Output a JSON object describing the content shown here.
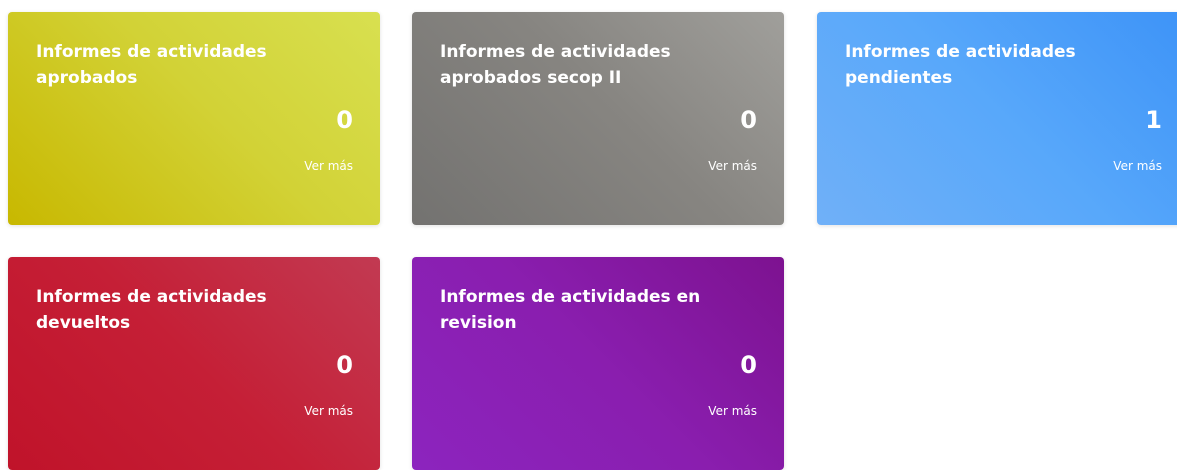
{
  "cards": [
    {
      "title": "Informes de actividades aprobados",
      "count": "0",
      "link": "Ver más"
    },
    {
      "title": "Informes de actividades aprobados secop II",
      "count": "0",
      "link": "Ver más"
    },
    {
      "title": "Informes de actividades pendientes",
      "count": "1",
      "link": "Ver más"
    },
    {
      "title": "Informes de actividades devueltos",
      "count": "0",
      "link": "Ver más"
    },
    {
      "title": "Informes de actividades en revision",
      "count": "0",
      "link": "Ver más"
    }
  ],
  "colors": {
    "aprobados": "#d2d236",
    "aprobados_secop_ii": "#878581",
    "pendientes": "#58a8fa",
    "devueltos": "#c51f36",
    "en_revision": "#8a1eaf"
  }
}
